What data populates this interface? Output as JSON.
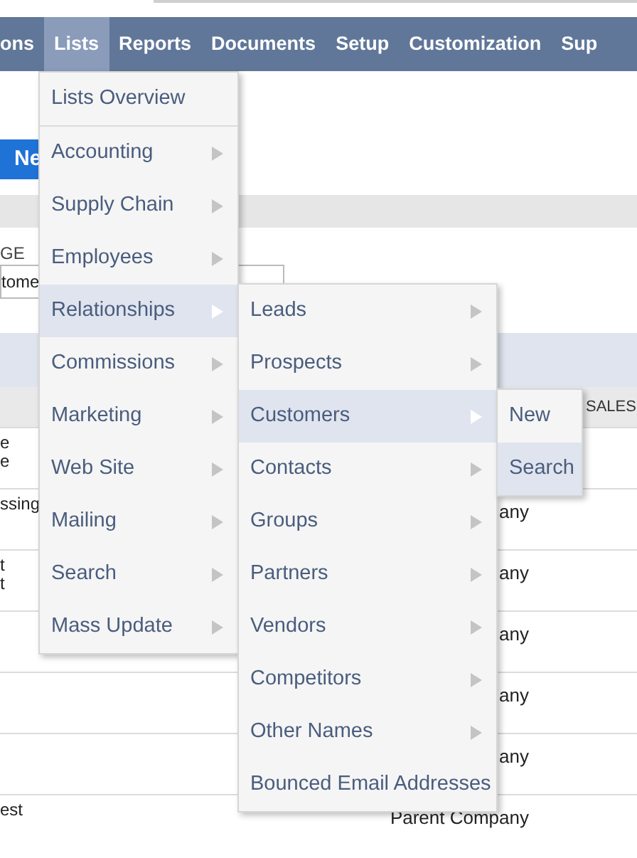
{
  "nav": {
    "items": [
      {
        "label": "ons",
        "selected": false
      },
      {
        "label": "Lists",
        "selected": true
      },
      {
        "label": "Reports",
        "selected": false
      },
      {
        "label": "Documents",
        "selected": false
      },
      {
        "label": "Setup",
        "selected": false
      },
      {
        "label": "Customization",
        "selected": false
      },
      {
        "label": "Sup",
        "selected": false
      }
    ]
  },
  "page": {
    "new_button": "Ne",
    "field_label": "GE",
    "field_value": "tome",
    "table": {
      "header_right": "SALES",
      "rows": [
        {
          "left": [
            "e",
            "e"
          ]
        },
        {
          "left": [
            "ssing"
          ],
          "right": "any"
        },
        {
          "left": [
            "t",
            "t"
          ],
          "right": "any"
        },
        {
          "right": "any"
        },
        {
          "right": "any"
        },
        {
          "right": "any"
        },
        {
          "left": [
            "est"
          ],
          "right": "Parent Company"
        }
      ]
    }
  },
  "menu": {
    "items": [
      {
        "label": "Lists Overview",
        "selected": false,
        "has_submenu": false
      },
      {
        "label": "Accounting",
        "selected": false,
        "has_submenu": true
      },
      {
        "label": "Supply Chain",
        "selected": false,
        "has_submenu": true
      },
      {
        "label": "Employees",
        "selected": false,
        "has_submenu": true
      },
      {
        "label": "Relationships",
        "selected": true,
        "has_submenu": true,
        "children": [
          {
            "label": "Leads",
            "selected": false,
            "has_submenu": true
          },
          {
            "label": "Prospects",
            "selected": false,
            "has_submenu": true
          },
          {
            "label": "Customers",
            "selected": true,
            "has_submenu": true,
            "children": [
              {
                "label": "New",
                "selected": false,
                "has_submenu": false
              },
              {
                "label": "Search",
                "selected": true,
                "has_submenu": false
              }
            ]
          },
          {
            "label": "Contacts",
            "selected": false,
            "has_submenu": true
          },
          {
            "label": "Groups",
            "selected": false,
            "has_submenu": true
          },
          {
            "label": "Partners",
            "selected": false,
            "has_submenu": true
          },
          {
            "label": "Vendors",
            "selected": false,
            "has_submenu": true
          },
          {
            "label": "Competitors",
            "selected": false,
            "has_submenu": true
          },
          {
            "label": "Other Names",
            "selected": false,
            "has_submenu": true
          },
          {
            "label": "Bounced Email Addresses",
            "selected": false,
            "has_submenu": false
          }
        ]
      },
      {
        "label": "Commissions",
        "selected": false,
        "has_submenu": true
      },
      {
        "label": "Marketing",
        "selected": false,
        "has_submenu": true
      },
      {
        "label": "Web Site",
        "selected": false,
        "has_submenu": true
      },
      {
        "label": "Mailing",
        "selected": false,
        "has_submenu": true
      },
      {
        "label": "Search",
        "selected": false,
        "has_submenu": true
      },
      {
        "label": "Mass Update",
        "selected": false,
        "has_submenu": true
      }
    ]
  }
}
